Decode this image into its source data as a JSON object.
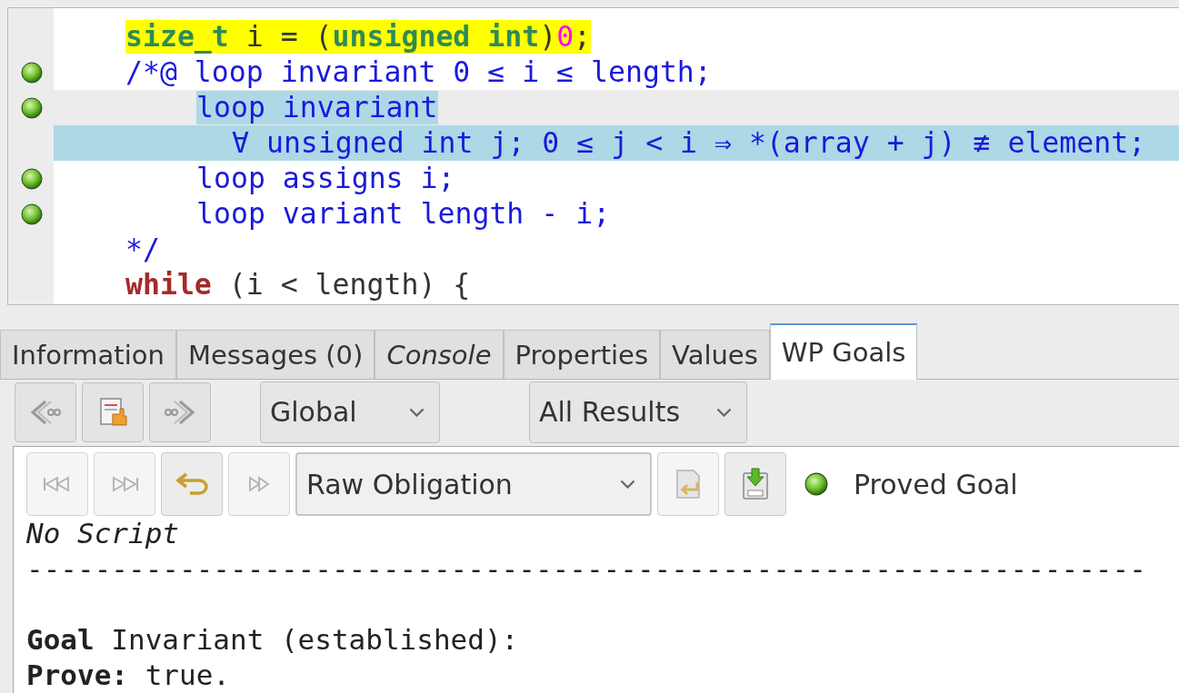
{
  "code": {
    "lines": [
      {
        "proved": false,
        "highlighted": true,
        "selected": false,
        "current": false,
        "tokens": [
          {
            "kind": "type",
            "text": "size_t"
          },
          {
            "kind": "plain",
            "text": " i = ("
          },
          {
            "kind": "type",
            "text": "unsigned int"
          },
          {
            "kind": "plain",
            "text": ")"
          },
          {
            "kind": "number",
            "text": "0"
          },
          {
            "kind": "plain",
            "text": ";"
          }
        ]
      },
      {
        "proved": true,
        "highlighted": false,
        "selected": false,
        "current": false,
        "tokens": [
          {
            "kind": "acsl",
            "text": "/*@ loop invariant 0 ≤ i ≤ length;"
          }
        ],
        "children": [
          {
            "proved": true,
            "highlighted": false,
            "selected": true,
            "current": true,
            "tokens": [
              {
                "kind": "acsl",
                "text": "loop invariant"
              }
            ],
            "children": [
              {
                "proved": false,
                "highlighted": false,
                "selected": true,
                "current": false,
                "tokens": [
                  {
                    "kind": "acsl",
                    "text": "∀ unsigned int j; 0 ≤ j < i ⇒ *(array + j) ≢ element;"
                  }
                ]
              }
            ]
          },
          {
            "proved": true,
            "highlighted": false,
            "selected": false,
            "current": false,
            "tokens": [
              {
                "kind": "acsl",
                "text": "loop assigns i;"
              }
            ]
          },
          {
            "proved": true,
            "highlighted": false,
            "selected": false,
            "current": false,
            "tokens": [
              {
                "kind": "acsl",
                "text": "loop variant length - i;"
              }
            ]
          }
        ]
      },
      {
        "proved": false,
        "highlighted": false,
        "selected": false,
        "current": false,
        "tokens": [
          {
            "kind": "acsl",
            "text": "*/"
          }
        ]
      },
      {
        "proved": false,
        "highlighted": false,
        "selected": false,
        "current": false,
        "tokens": [
          {
            "kind": "keyword",
            "text": "while"
          },
          {
            "kind": "plain",
            "text": " (i < length) {"
          }
        ]
      }
    ]
  },
  "tabs": [
    {
      "label": "Information",
      "selected": false,
      "italic": false
    },
    {
      "label": "Messages (0)",
      "selected": false,
      "italic": false
    },
    {
      "label": "Console",
      "selected": false,
      "italic": true
    },
    {
      "label": "Properties",
      "selected": false,
      "italic": false
    },
    {
      "label": "Values",
      "selected": false,
      "italic": false
    },
    {
      "label": "WP Goals",
      "selected": true,
      "italic": false
    }
  ],
  "toolbar": {
    "buttons": [
      {
        "kind": "back"
      },
      {
        "kind": "document"
      },
      {
        "kind": "forward"
      }
    ],
    "dropdowns": [
      {
        "value": "Global"
      },
      {
        "value": "All Results"
      }
    ]
  },
  "goal_panel": {
    "buttons_left": [
      {
        "kind": "first",
        "disabled": true
      },
      {
        "kind": "last",
        "disabled": true
      },
      {
        "kind": "undo",
        "disabled": false
      },
      {
        "kind": "play",
        "disabled": true
      }
    ],
    "view_dropdown": {
      "value": "Raw Obligation"
    },
    "buttons_right": [
      {
        "kind": "replay",
        "disabled": true
      },
      {
        "kind": "save",
        "disabled": false
      }
    ],
    "status": {
      "proved": true,
      "label": "Proved Goal"
    },
    "lines": [
      {
        "kind": "italic",
        "text": "No Script"
      },
      {
        "kind": "separator",
        "text": "------------------------------------------------------------------"
      },
      {
        "kind": "rich",
        "text": "**Goal** Invariant (established):"
      },
      {
        "kind": "rich",
        "text": "**Prove:** true."
      }
    ]
  }
}
